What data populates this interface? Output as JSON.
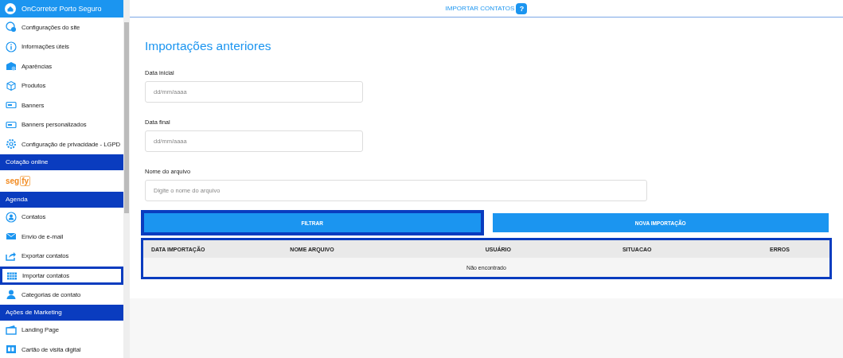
{
  "sidebar": {
    "header": {
      "label": "OnCorretor Porto Seguro"
    },
    "items": [
      {
        "kind": "link",
        "label": "Configurações do site",
        "selected": false
      },
      {
        "kind": "link",
        "label": "Informações úteis",
        "selected": false
      },
      {
        "kind": "link",
        "label": "Aparências",
        "selected": false
      },
      {
        "kind": "link",
        "label": "Produtos",
        "selected": false
      },
      {
        "kind": "link",
        "label": "Banners",
        "selected": false
      },
      {
        "kind": "link",
        "label": "Banners personalizados",
        "selected": false
      },
      {
        "kind": "link",
        "label": "Configuração de privacidade - LGPD",
        "selected": false
      },
      {
        "kind": "section",
        "label": "Cotação online"
      },
      {
        "kind": "logo",
        "parts": [
          "seg",
          "fy"
        ]
      },
      {
        "kind": "section",
        "label": "Agenda"
      },
      {
        "kind": "link",
        "label": "Contatos",
        "selected": false
      },
      {
        "kind": "link",
        "label": "Envio de e-mail",
        "selected": false
      },
      {
        "kind": "link",
        "label": "Exportar contatos",
        "selected": false
      },
      {
        "kind": "link",
        "label": "Importar contatos",
        "selected": true
      },
      {
        "kind": "link",
        "label": "Categorias de contato",
        "selected": false
      },
      {
        "kind": "section",
        "label": "Ações de Marketing"
      },
      {
        "kind": "link",
        "label": "Landing Page",
        "selected": false
      },
      {
        "kind": "link",
        "label": "Cartão de visita digital",
        "selected": false
      }
    ]
  },
  "topbar": {
    "title": "IMPORTAR CONTATOS",
    "help": "?"
  },
  "main": {
    "heading": "Importações anteriores",
    "fields": [
      {
        "label": "Data inicial",
        "placeholder": "dd/mm/aaaa",
        "wide": false
      },
      {
        "label": "Data final",
        "placeholder": "dd/mm/aaaa",
        "wide": false
      },
      {
        "label": "Nome do arquivo",
        "placeholder": "Digite o nome do arquivo",
        "wide": true
      }
    ],
    "buttons": [
      {
        "label": "FILTRAR",
        "highlighted": true
      },
      {
        "label": "NOVA IMPORTAÇÃO",
        "highlighted": false
      }
    ],
    "table": {
      "highlighted": true,
      "columns": [
        "DATA IMPORTAÇÃO",
        "NOME ARQUIVO",
        "USUÁRIO",
        "SITUACAO",
        "ERROS"
      ],
      "empty": "Não encontrado"
    }
  }
}
